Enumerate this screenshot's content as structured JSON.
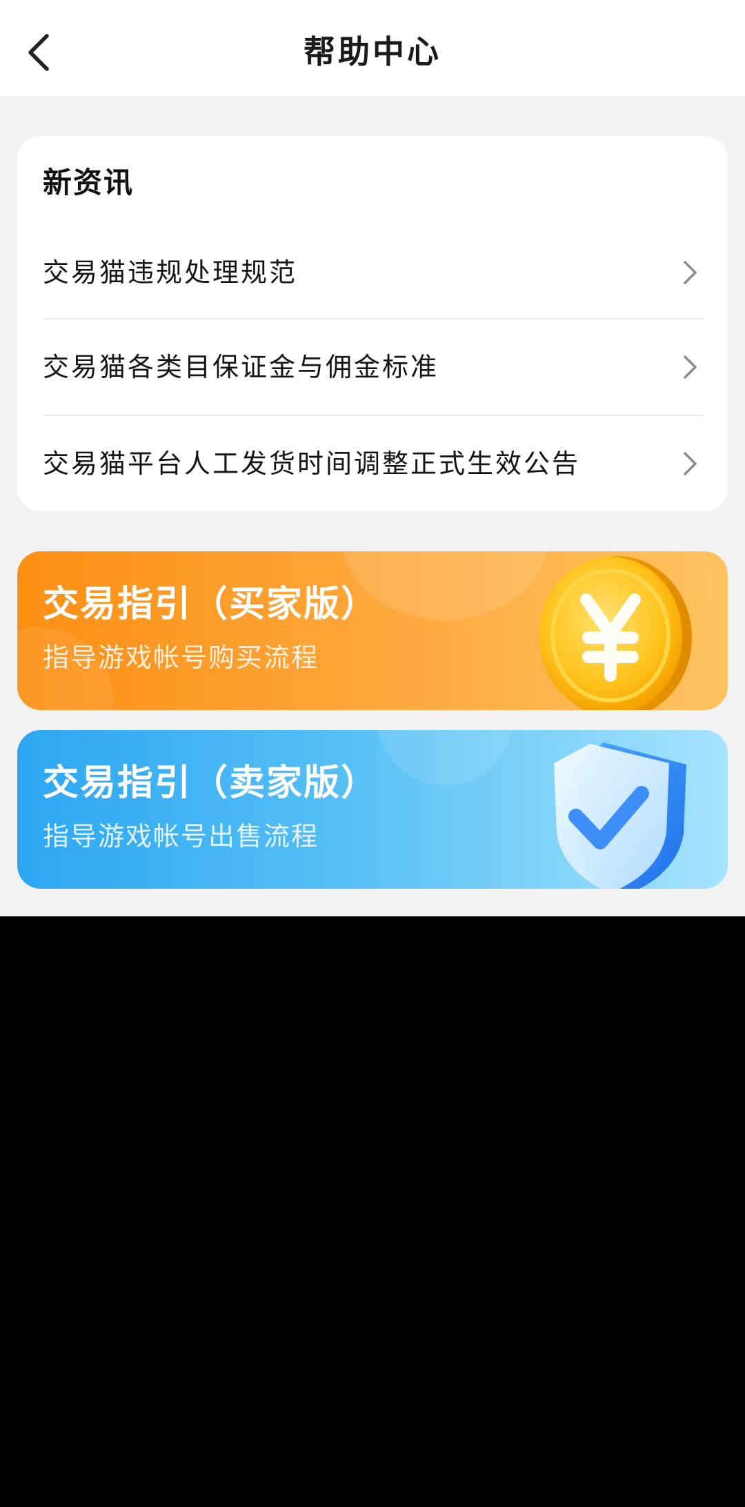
{
  "header": {
    "title": "帮助中心",
    "back_icon": "chevron-left-icon"
  },
  "news": {
    "heading": "新资讯",
    "items": [
      {
        "label": "交易猫违规处理规范"
      },
      {
        "label": "交易猫各类目保证金与佣金标准"
      },
      {
        "label": "交易猫平台人工发货时间调整正式生效公告"
      }
    ]
  },
  "banners": {
    "buyer": {
      "title": "交易指引（买家版）",
      "subtitle": "指导游戏帐号购买流程",
      "icon": "yuan-coin-icon",
      "color": "#fb8f14"
    },
    "seller": {
      "title": "交易指引（卖家版）",
      "subtitle": "指导游戏帐号出售流程",
      "icon": "shield-check-icon",
      "color": "#2da6f2"
    }
  }
}
